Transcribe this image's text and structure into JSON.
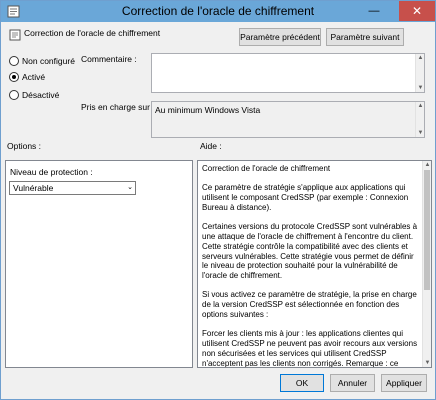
{
  "window": {
    "title": "Correction de l'oracle de chiffrement",
    "minimize": "—",
    "maximize": "□",
    "close": "✕"
  },
  "header": {
    "policy_name": "Correction de l'oracle de chiffrement"
  },
  "nav": {
    "prev_label": "Paramètre précédent",
    "next_label": "Paramètre suivant"
  },
  "state": {
    "options": [
      {
        "label": "Non configuré",
        "selected": false
      },
      {
        "label": "Activé",
        "selected": true
      },
      {
        "label": "Désactivé",
        "selected": false
      }
    ]
  },
  "comment": {
    "label": "Commentaire :",
    "value": ""
  },
  "support": {
    "label": "Pris en charge sur :",
    "value": "Au minimum Windows Vista"
  },
  "sections": {
    "options": "Options :",
    "help": "Aide :"
  },
  "options": {
    "protection_label": "Niveau de protection :",
    "protection_value": "Vulnérable",
    "arrow": "⌄"
  },
  "help": {
    "paragraphs": [
      "Correction de l'oracle de chiffrement",
      "Ce paramètre de stratégie s'applique aux applications qui utilisent le composant CredSSP (par exemple : Connexion Bureau à distance).",
      "Certaines versions du protocole CredSSP sont vulnérables à une attaque de l'oracle de chiffrement à l'encontre du client. Cette stratégie contrôle la compatibilité avec des clients et serveurs vulnérables. Cette stratégie vous permet de définir le niveau de protection souhaité pour la vulnérabilité de l'oracle de chiffrement.",
      "Si vous activez ce paramètre de stratégie, la prise en charge de la version CredSSP est sélectionnée en fonction des options suivantes :",
      "Forcer les clients mis à jour : les applications clientes qui utilisent CredSSP ne peuvent pas avoir recours aux versions non sécurisées et les services qui utilisent CredSSP n'acceptent pas les clients non corrigés. Remarque : ce paramètre ne doit pas être"
    ]
  },
  "footer": {
    "ok": "OK",
    "cancel": "Annuler",
    "apply": "Appliquer"
  },
  "colors": {
    "titlebar": "#6aa7d8",
    "close": "#c7504b"
  }
}
